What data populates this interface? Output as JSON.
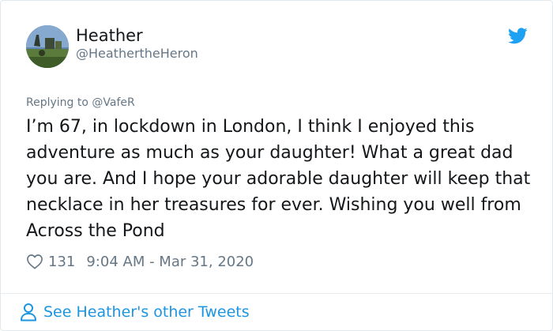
{
  "author": {
    "name": "Heather",
    "handle": "@HeathertheHeron"
  },
  "reply_to": "Replying to @VafeR",
  "tweet_text": "I’m 67, in lockdown in London, I think I enjoyed this adventure as much as your daughter! What a great dad you are. And I hope your adorable daughter will keep that necklace in her treasures for ever. Wishing you well from Across the Pond",
  "likes": "131",
  "timestamp": "9:04 AM - Mar 31, 2020",
  "footer": {
    "see_more": "See Heather's other Tweets"
  },
  "icons": {
    "brand": "twitter-bird-icon",
    "like": "heart-icon",
    "profile": "person-icon"
  },
  "colors": {
    "twitter_blue": "#1da1f2",
    "link_blue": "#1b95e0",
    "secondary_text": "#657786"
  }
}
